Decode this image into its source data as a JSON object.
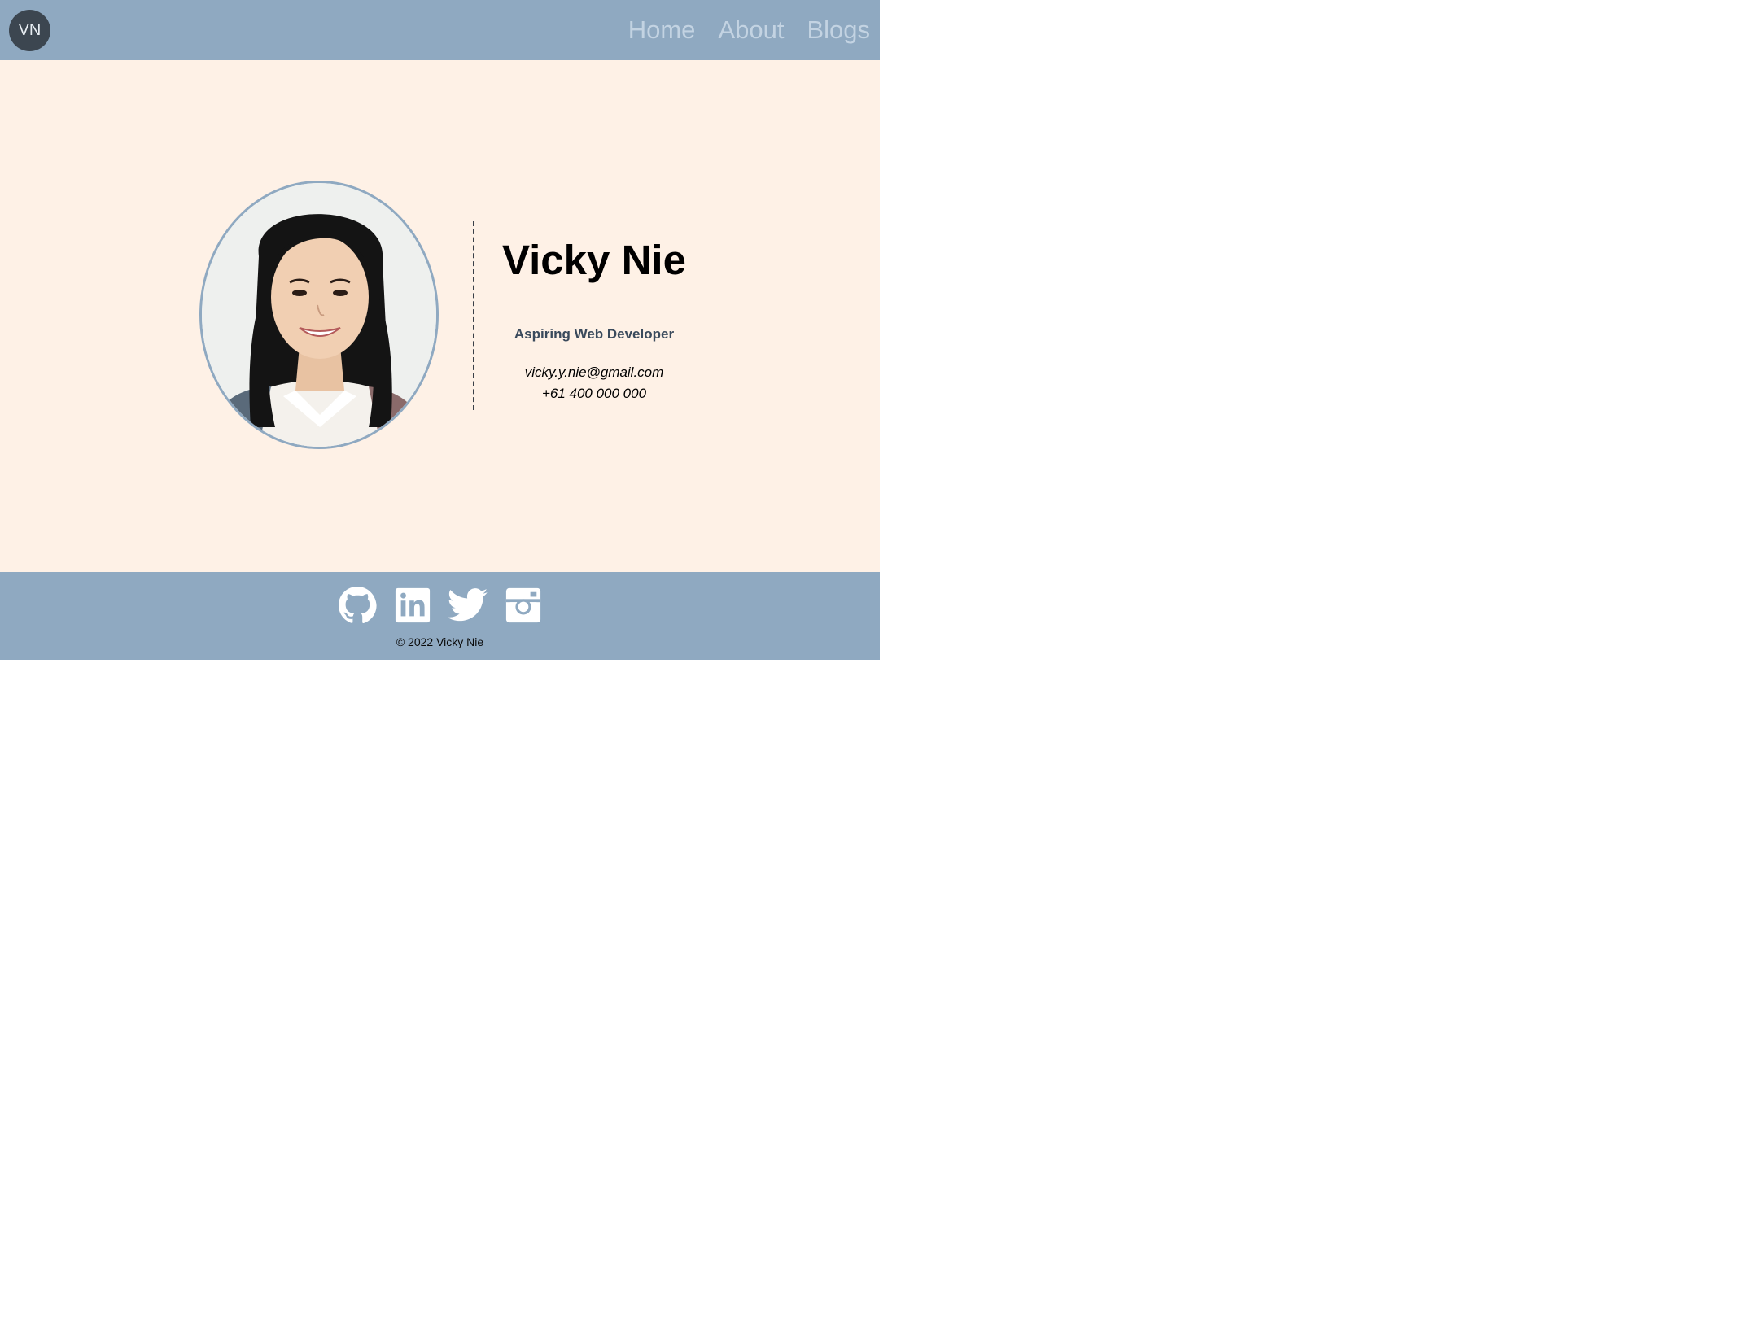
{
  "header": {
    "logo_text": "VN",
    "nav": [
      {
        "label": "Home"
      },
      {
        "label": "About"
      },
      {
        "label": "Blogs"
      }
    ]
  },
  "profile": {
    "portrait_icon": "portrait-photo",
    "name": "Vicky Nie",
    "role": "Aspiring Web Developer",
    "email": "vicky.y.nie@gmail.com",
    "phone": "+61 400 000 000"
  },
  "footer": {
    "social_icons": [
      "github-icon",
      "linkedin-icon",
      "twitter-icon",
      "instagram-icon"
    ],
    "copyright": "© 2022 Vicky Nie"
  },
  "colors": {
    "header_bg": "#8fa9c1",
    "main_bg": "#fef1e6",
    "logo_bg": "#3c4650",
    "nav_text": "#c3d3e2"
  }
}
